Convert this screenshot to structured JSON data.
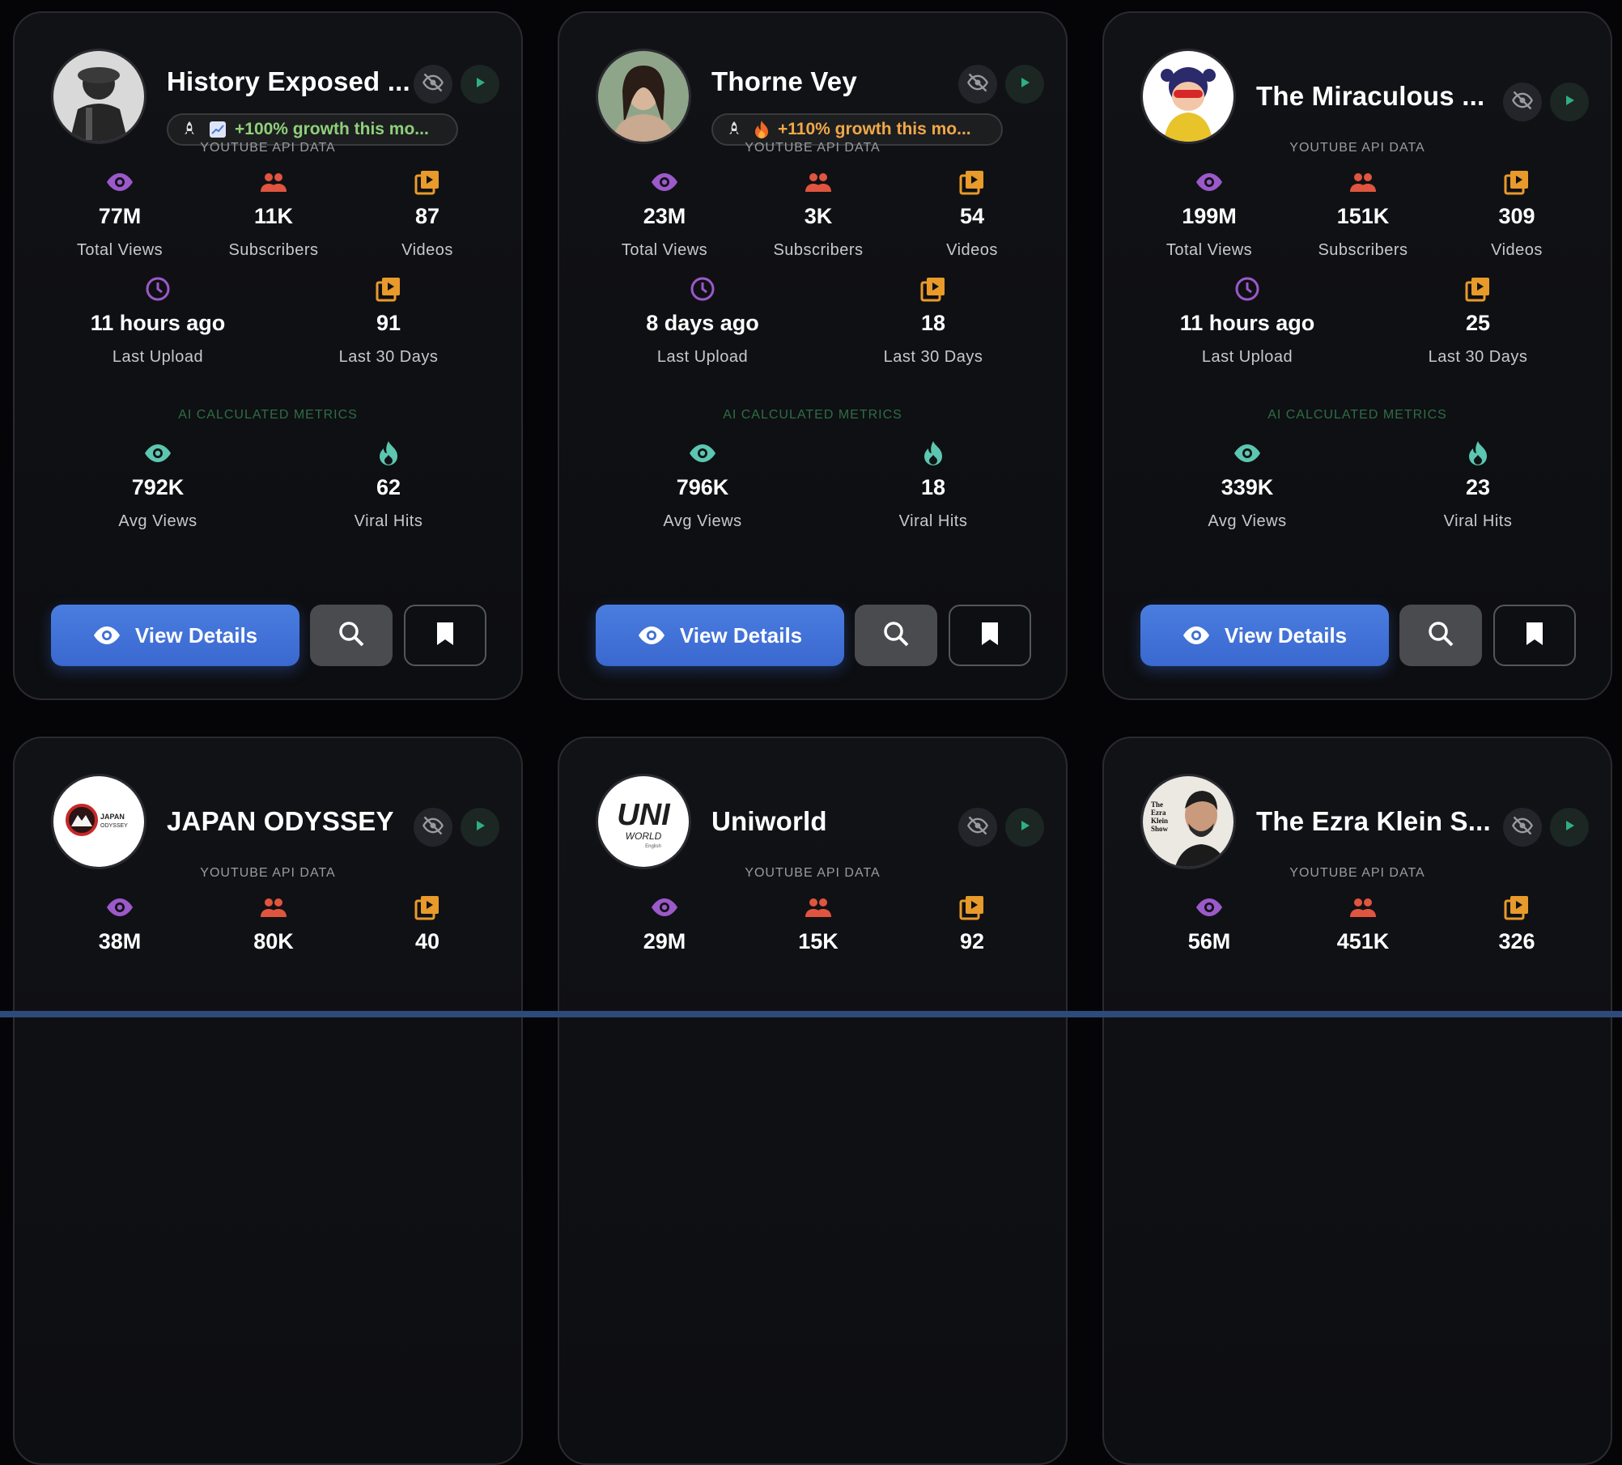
{
  "colors": {
    "views": "#9b59c9",
    "subscribers": "#e0553f",
    "videos": "#e89a2a",
    "last_upload": "#9b59c9",
    "ai": "#5cc6b0",
    "primary_button": "#3f6fd6"
  },
  "labels": {
    "api_section": "YOUTUBE API DATA",
    "ai_section": "AI CALCULATED METRICS",
    "total_views": "Total Views",
    "subscribers": "Subscribers",
    "videos": "Videos",
    "last_upload": "Last Upload",
    "last_30_days": "Last 30 Days",
    "avg_views": "Avg Views",
    "viral_hits": "Viral Hits",
    "view_details": "View Details"
  },
  "cards": [
    {
      "name": "History Exposed ...",
      "badge_icon": "chart-up-icon",
      "badge_text": "+100% growth this mo...",
      "total_views": "77M",
      "subscribers": "11K",
      "videos": "87",
      "last_upload": "11 hours ago",
      "last_30_days": "91",
      "avg_views": "792K",
      "viral_hits": "62"
    },
    {
      "name": "Thorne Vey",
      "badge_icon": "fire-icon",
      "badge_text": "+110% growth this mo...",
      "total_views": "23M",
      "subscribers": "3K",
      "videos": "54",
      "last_upload": "8 days ago",
      "last_30_days": "18",
      "avg_views": "796K",
      "viral_hits": "18"
    },
    {
      "name": "The Miraculous ...",
      "total_views": "199M",
      "subscribers": "151K",
      "videos": "309",
      "last_upload": "11 hours ago",
      "last_30_days": "25",
      "avg_views": "339K",
      "viral_hits": "23"
    },
    {
      "name": "JAPAN ODYSSEY",
      "avatar_text": [
        "JAPAN",
        "ODYSSEY"
      ],
      "total_views": "38M",
      "subscribers": "80K",
      "videos": "40"
    },
    {
      "name": "Uniworld",
      "avatar_text": [
        "UNI",
        "WORLD",
        "English"
      ],
      "total_views": "29M",
      "subscribers": "15K",
      "videos": "92"
    },
    {
      "name": "The Ezra Klein S...",
      "avatar_text": [
        "The",
        "Ezra",
        "Klein",
        "Show"
      ],
      "total_views": "56M",
      "subscribers": "451K",
      "videos": "326"
    }
  ]
}
